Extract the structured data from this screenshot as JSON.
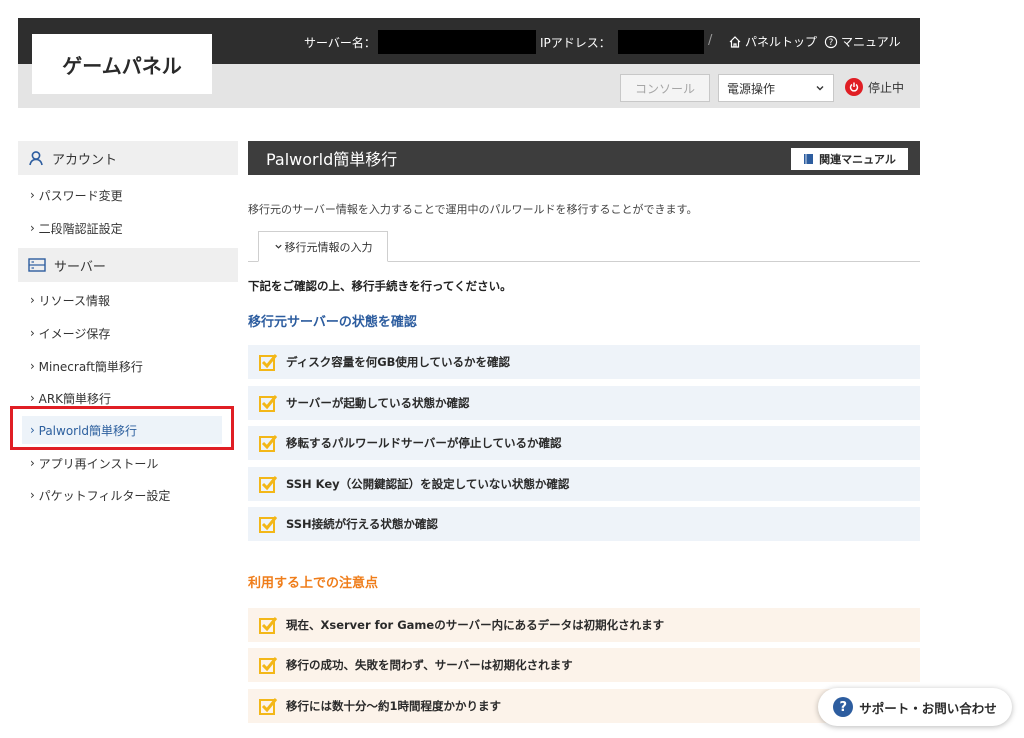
{
  "header": {
    "logo": "ゲームパネル",
    "server_name_label": "サーバー名：",
    "ip_label": "IPアドレス：",
    "separator": "/",
    "panel_top": "パネルトップ",
    "manual": "マニュアル",
    "console_button": "コンソール",
    "power_select": "電源操作",
    "status": "停止中"
  },
  "sidebar": {
    "account_head": "アカウント",
    "account_items": [
      "パスワード変更",
      "二段階認証設定"
    ],
    "server_head": "サーバー",
    "server_items": [
      "リソース情報",
      "イメージ保存",
      "Minecraft簡単移行",
      "ARK簡単移行",
      "Palworld簡単移行",
      "アプリ再インストール",
      "パケットフィルター設定"
    ]
  },
  "main": {
    "title": "Palworld簡単移行",
    "manual_button": "関連マニュアル",
    "description": "移行元のサーバー情報を入力することで運用中のパルワールドを移行することができます。",
    "tab": "移行元情報の入力",
    "notice": "下記をご確認の上、移行手続きを行ってください。",
    "check_heading": "移行元サーバーの状態を確認",
    "checks": [
      "ディスク容量を何GB使用しているかを確認",
      "サーバーが起動している状態か確認",
      "移転するパルワールドサーバーが停止しているか確認",
      "SSH Key（公開鍵認証）を設定していない状態か確認",
      "SSH接続が行える状態か確認"
    ],
    "caution_heading": "利用する上での注意点",
    "cautions": [
      "現在、Xserver for Gameのサーバー内にあるデータは初期化されます",
      "移行の成功、失敗を問わず、サーバーは初期化されます",
      "移行には数十分〜約1時間程度かかります"
    ]
  },
  "support": "サポート・お問い合わせ",
  "colors": {
    "header_dark": "#2e2e2e",
    "accent_blue": "#2d5d9f",
    "accent_orange": "#ef7d1a",
    "status_red": "#e01e24",
    "check_yellow": "#f3b718"
  }
}
